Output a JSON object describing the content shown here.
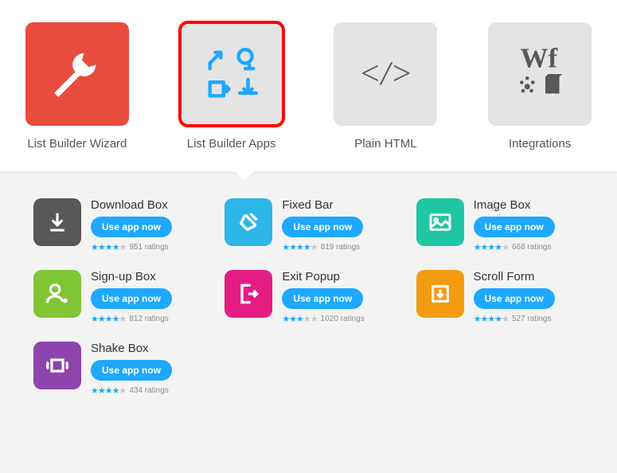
{
  "tabs": [
    {
      "label": "List Builder Wizard"
    },
    {
      "label": "List Builder Apps"
    },
    {
      "label": "Plain HTML"
    },
    {
      "label": "Integrations"
    }
  ],
  "button_label": "Use app now",
  "apps": [
    {
      "name": "Download Box",
      "ratings": "951 ratings",
      "stars": 4
    },
    {
      "name": "Fixed Bar",
      "ratings": "819 ratings",
      "stars": 4
    },
    {
      "name": "Image Box",
      "ratings": "668 ratings",
      "stars": 4
    },
    {
      "name": "Sign-up Box",
      "ratings": "812 ratings",
      "stars": 4
    },
    {
      "name": "Exit Popup",
      "ratings": "1020 ratings",
      "stars": 3.5
    },
    {
      "name": "Scroll Form",
      "ratings": "527 ratings",
      "stars": 4
    },
    {
      "name": "Shake Box",
      "ratings": "434 ratings",
      "stars": 4
    }
  ]
}
